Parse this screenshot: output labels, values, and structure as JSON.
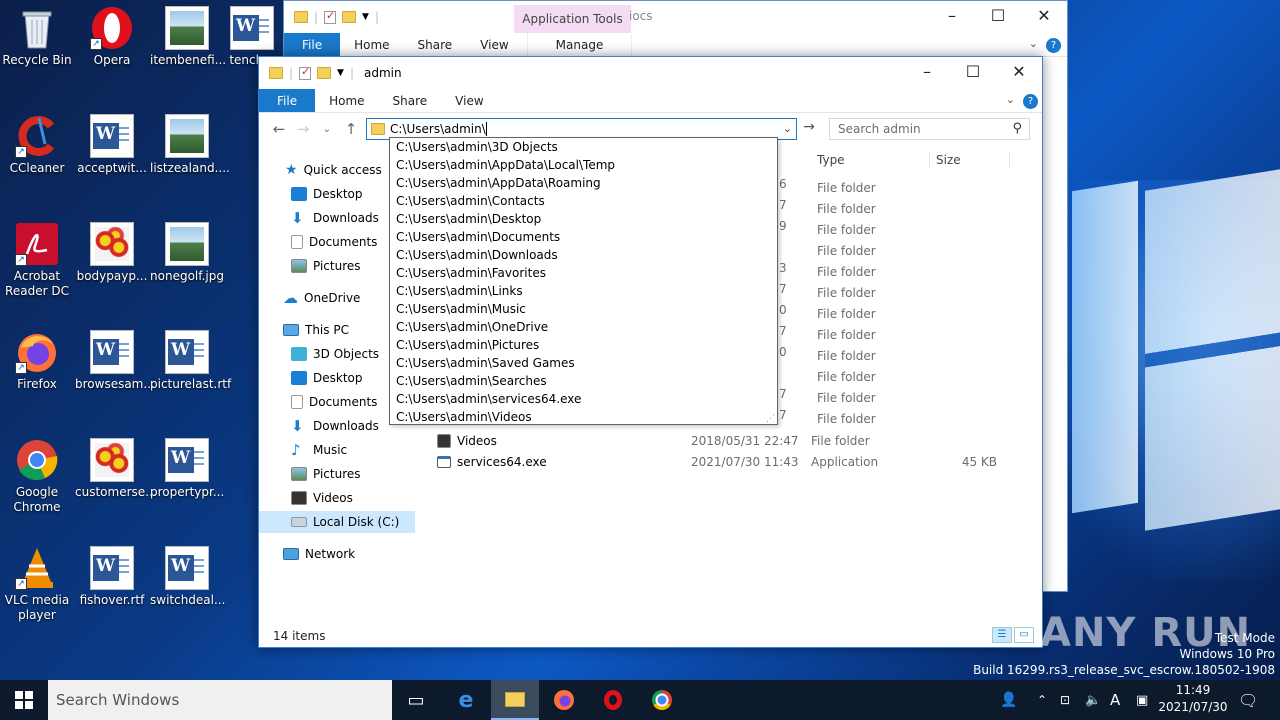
{
  "desktop": {
    "icons": [
      {
        "label": "Recycle Bin"
      },
      {
        "label": "Opera"
      },
      {
        "label": "itembenefi..."
      },
      {
        "label": "tench..."
      },
      {
        "label": "CCleaner"
      },
      {
        "label": "acceptwit..."
      },
      {
        "label": "listzealand...."
      },
      {
        "label": "Acrobat Reader DC"
      },
      {
        "label": "bodypayp..."
      },
      {
        "label": "nonegolf.jpg"
      },
      {
        "label": "Firefox"
      },
      {
        "label": "browsesam..."
      },
      {
        "label": "picturelast.rtf"
      },
      {
        "label": "Google Chrome"
      },
      {
        "label": "customerse..."
      },
      {
        "label": "propertypr..."
      },
      {
        "label": "VLC media player"
      },
      {
        "label": "fishover.rtf"
      },
      {
        "label": "switchdeal..."
      }
    ]
  },
  "back_window": {
    "context_tab": "Application Tools",
    "title": "iocs",
    "tabs": [
      "File",
      "Home",
      "Share",
      "View",
      "Manage"
    ]
  },
  "window": {
    "title": "admin",
    "tabs": [
      "File",
      "Home",
      "Share",
      "View"
    ],
    "address": "C:\\Users\\admin\\",
    "search_placeholder": "Search admin",
    "nav": {
      "quick_access": "Quick access",
      "qa_items": [
        "Desktop",
        "Downloads",
        "Documents",
        "Pictures"
      ],
      "onedrive": "OneDrive",
      "this_pc": "This PC",
      "pc_items": [
        "3D Objects",
        "Desktop",
        "Documents",
        "Downloads",
        "Music",
        "Pictures",
        "Videos",
        "Local Disk (C:)"
      ],
      "network": "Network"
    },
    "columns": {
      "type": "Type",
      "size": "Size"
    },
    "partial_dates": [
      "6",
      "7",
      "9",
      "",
      "3",
      "7",
      "0",
      "7",
      "0",
      "",
      "7",
      "7"
    ],
    "hidden_types": [
      "File folder",
      "File folder",
      "File folder",
      "File folder",
      "File folder",
      "File folder",
      "File folder",
      "File folder",
      "File folder",
      "File folder",
      "File folder",
      "File folder"
    ],
    "rows": [
      {
        "name": "Videos",
        "date": "2018/05/31 22:47",
        "type": "File folder",
        "size": ""
      },
      {
        "name": "services64.exe",
        "date": "2021/07/30 11:43",
        "type": "Application",
        "size": "45 KB"
      }
    ],
    "status": "14 items"
  },
  "autocomplete": [
    "C:\\Users\\admin\\3D Objects",
    "C:\\Users\\admin\\AppData\\Local\\Temp",
    "C:\\Users\\admin\\AppData\\Roaming",
    "C:\\Users\\admin\\Contacts",
    "C:\\Users\\admin\\Desktop",
    "C:\\Users\\admin\\Documents",
    "C:\\Users\\admin\\Downloads",
    "C:\\Users\\admin\\Favorites",
    "C:\\Users\\admin\\Links",
    "C:\\Users\\admin\\Music",
    "C:\\Users\\admin\\OneDrive",
    "C:\\Users\\admin\\Pictures",
    "C:\\Users\\admin\\Saved Games",
    "C:\\Users\\admin\\Searches",
    "C:\\Users\\admin\\services64.exe",
    "C:\\Users\\admin\\Videos"
  ],
  "taskbar": {
    "search_text": "Search Windows",
    "time": "11:49",
    "date": "2021/07/30"
  },
  "watermark": {
    "brand": "ANY RUN",
    "test_mode": "Test Mode",
    "edition": "Windows 10 Pro",
    "build": "Build 16299.rs3_release_svc_escrow.180502-1908"
  }
}
